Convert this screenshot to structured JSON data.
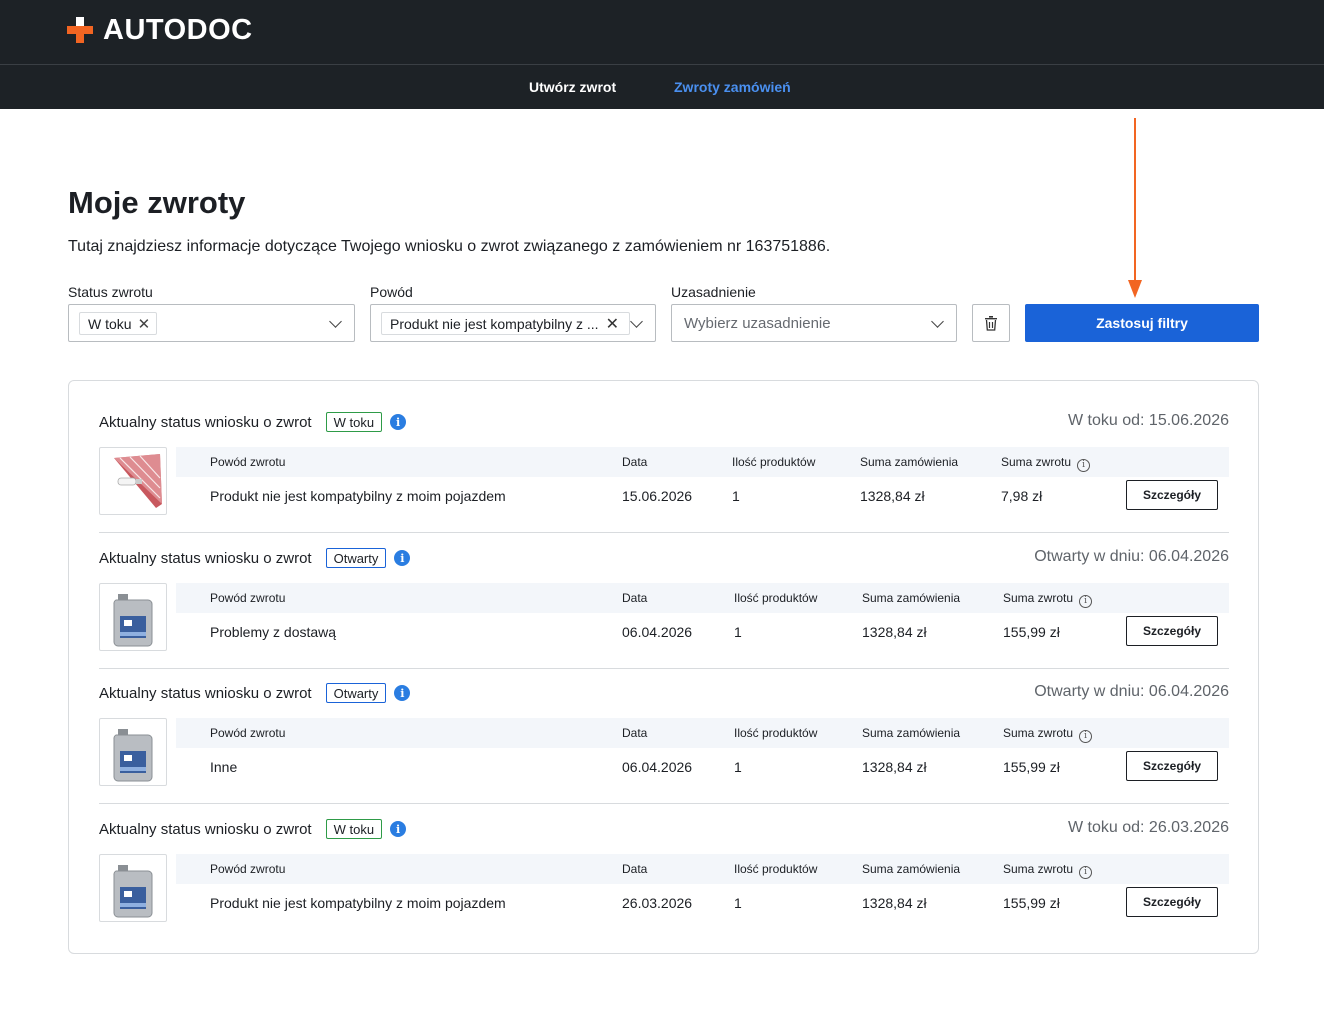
{
  "brand": {
    "name": "AUTODOC",
    "accent": "#f26522"
  },
  "nav": {
    "create_return": "Utwórz zwrot",
    "order_returns": "Zwroty zamówień"
  },
  "page": {
    "title": "Moje zwroty",
    "description": "Tutaj znajdziesz informacje dotyczące Twojego wniosku o zwrot związanego z zamówieniem nr 163751886."
  },
  "filters": {
    "status_label": "Status zwrotu",
    "status_value": "W toku",
    "reason_label": "Powód",
    "reason_value": "Produkt nie jest kompatybilny z ...",
    "justification_label": "Uzasadnienie",
    "justification_placeholder": "Wybierz uzasadnienie",
    "apply_label": "Zastosuj filtry"
  },
  "table_headers": {
    "reason": "Powód zwrotu",
    "date": "Data",
    "qty": "Ilość produktów",
    "order_sum": "Suma zamówienia",
    "return_sum": "Suma zwrotu"
  },
  "status_prefix": "Aktualny status wniosku o zwrot",
  "details_label": "Szczegóły",
  "returns": [
    {
      "status": "W toku",
      "status_color": "green",
      "status_date": "W toku od: 15.06.2026",
      "reason": "Produkt nie jest kompatybilny z moim pojazdem",
      "date": "15.06.2026",
      "qty": "1",
      "order_sum": "1328,84 zł",
      "return_sum": "7,98 zł",
      "thumb": "bulb"
    },
    {
      "status": "Otwarty",
      "status_color": "blue",
      "status_date": "Otwarty w dniu: 06.04.2026",
      "reason": "Problemy z dostawą",
      "date": "06.04.2026",
      "qty": "1",
      "order_sum": "1328,84 zł",
      "return_sum": "155,99 zł",
      "thumb": "oil"
    },
    {
      "status": "Otwarty",
      "status_color": "blue",
      "status_date": "Otwarty w dniu: 06.04.2026",
      "reason": "Inne",
      "date": "06.04.2026",
      "qty": "1",
      "order_sum": "1328,84 zł",
      "return_sum": "155,99 zł",
      "thumb": "oil"
    },
    {
      "status": "W toku",
      "status_color": "green",
      "status_date": "W toku od: 26.03.2026",
      "reason": "Produkt nie jest kompatybilny z moim pojazdem",
      "date": "26.03.2026",
      "qty": "1",
      "order_sum": "1328,84 zł",
      "return_sum": "155,99 zł",
      "thumb": "oil"
    }
  ]
}
